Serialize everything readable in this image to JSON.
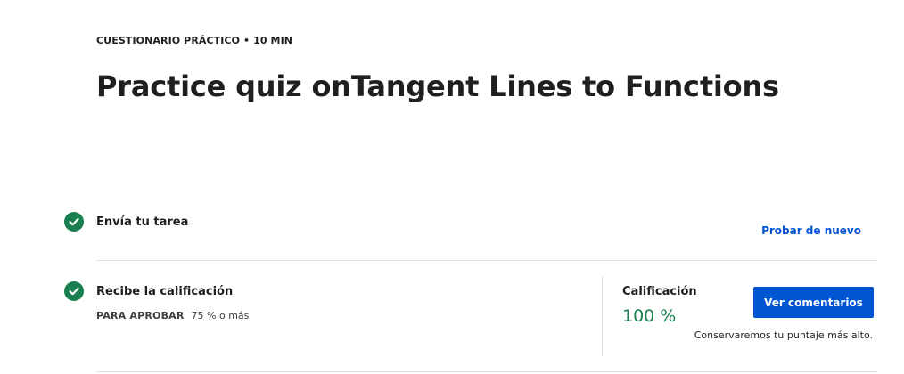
{
  "header": {
    "eyebrow": "CUESTIONARIO PRÁCTICO • 10 MIN",
    "title": "Practice quiz onTangent Lines to Functions"
  },
  "steps": {
    "submit": {
      "label": "Envía tu tarea",
      "action_label": "Probar de nuevo",
      "icon": "check-circle-icon",
      "status_color": "#1a7f4e"
    },
    "grade": {
      "label": "Recibe la calificación",
      "pass_label": "PARA APROBAR",
      "pass_value": "75 % o más",
      "icon": "check-circle-icon"
    }
  },
  "result": {
    "grade_label": "Calificación",
    "grade_value": "100 %",
    "feedback_button_label": "Ver comentarios",
    "note": "Conservaremos tu puntaje más alto."
  },
  "colors": {
    "accent": "#0056d2",
    "success": "#1a7f4e"
  }
}
